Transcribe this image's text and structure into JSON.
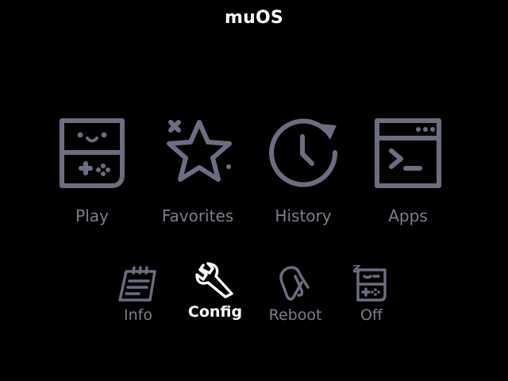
{
  "header": {
    "title": "muOS"
  },
  "menu": {
    "main": [
      {
        "label": "Play",
        "icon": "handheld-console-icon"
      },
      {
        "label": "Favorites",
        "icon": "star-icon"
      },
      {
        "label": "History",
        "icon": "clock-history-icon"
      },
      {
        "label": "Apps",
        "icon": "terminal-window-icon"
      }
    ],
    "system": [
      {
        "label": "Info",
        "icon": "notepad-icon"
      },
      {
        "label": "Config",
        "icon": "wrench-icon",
        "selected": true
      },
      {
        "label": "Reboot",
        "icon": "paperclip-icon"
      },
      {
        "label": "Off",
        "icon": "sleeping-console-icon"
      }
    ]
  },
  "colors": {
    "background": "#000000",
    "icon": "#6b6e80",
    "label": "#7c7f8c",
    "selected": "#ffffff"
  }
}
